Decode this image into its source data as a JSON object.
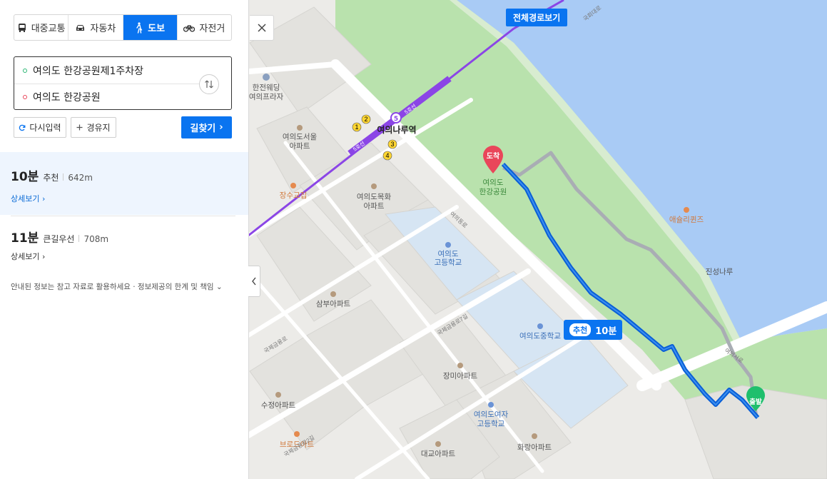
{
  "tabs": [
    {
      "label": "대중교통",
      "icon": "bus-icon",
      "active": false
    },
    {
      "label": "자동차",
      "icon": "car-icon",
      "active": false
    },
    {
      "label": "도보",
      "icon": "walk-icon",
      "active": true
    },
    {
      "label": "자전거",
      "icon": "bicycle-icon",
      "active": false
    }
  ],
  "route": {
    "origin": "여의도 한강공원제1주차장",
    "destination": "여의도 한강공원"
  },
  "buttons": {
    "reset": "다시입력",
    "via": "경유지",
    "search": "길찾기"
  },
  "results": [
    {
      "time": "10분",
      "type": "추천",
      "distance": "642m",
      "detail": "상세보기"
    },
    {
      "time": "11분",
      "type": "큰길우선",
      "distance": "708m",
      "detail": "상세보기"
    }
  ],
  "notice": "안내된 정보는 참고 자료로 활용하세요 · 정보제공의 한계 및 책임",
  "map": {
    "full_route_button": "전체경로보기",
    "recommend_badge": "추천",
    "recommend_time": "10분",
    "destination_marker": "도착",
    "origin_marker": "출발",
    "station": "여의나루역",
    "exits": [
      "1",
      "2",
      "3",
      "4",
      "5"
    ],
    "line_label": "5호선",
    "pois": [
      {
        "name": "한전웨딩",
        "sub": "여의프라자"
      },
      {
        "name": "여의도서울",
        "sub": "아파트"
      },
      {
        "name": "장수교집",
        "sub": ""
      },
      {
        "name": "여의도목화",
        "sub": "아파트"
      },
      {
        "name": "여의도",
        "sub": "고등학교"
      },
      {
        "name": "삼부아파트",
        "sub": ""
      },
      {
        "name": "여의도중학교",
        "sub": ""
      },
      {
        "name": "장미아파트",
        "sub": ""
      },
      {
        "name": "수정아파트",
        "sub": ""
      },
      {
        "name": "여의도여자",
        "sub": "고등학교"
      },
      {
        "name": "브로드아트",
        "sub": ""
      },
      {
        "name": "대교아파트",
        "sub": ""
      },
      {
        "name": "화랑아파트",
        "sub": ""
      },
      {
        "name": "여의도",
        "sub": "한강공원"
      },
      {
        "name": "애슐리퀸즈",
        "sub": ""
      },
      {
        "name": "진성나루",
        "sub": ""
      }
    ],
    "roads": [
      "여의동로",
      "국제금융로7길",
      "국제금융로",
      "국제금융로2길",
      "여의서로",
      "국회대로"
    ],
    "colors": {
      "route": "#0a5fd6",
      "alt_route": "#a9adb4",
      "subway": "#8b45e6",
      "park": "#b9e2ad",
      "water": "#a9cbf5",
      "accent": "#0a74f0"
    }
  }
}
